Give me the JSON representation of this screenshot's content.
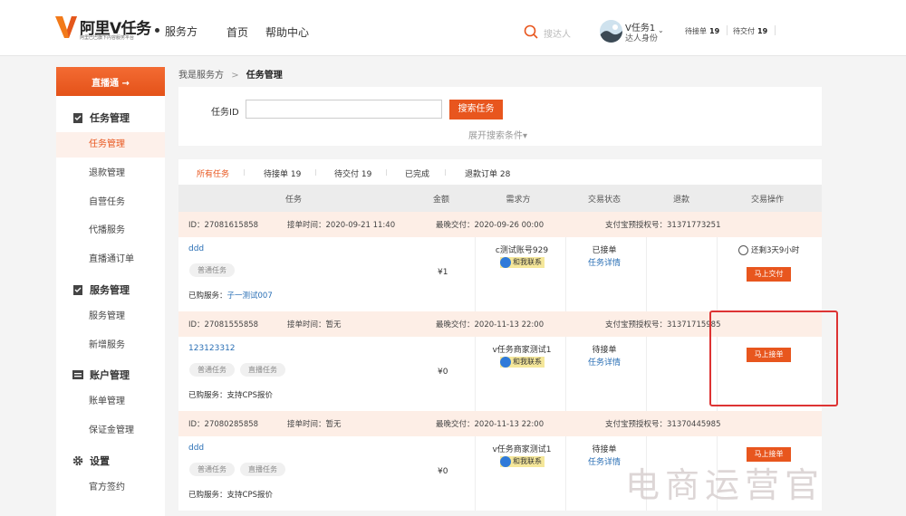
{
  "header": {
    "logo_title": "阿里V任务",
    "logo_sub": "阿里巴巴旗下内容服务平台",
    "service_label": "服务方",
    "nav": [
      "首页",
      "帮助中心"
    ],
    "search_placeholder": "搜达人",
    "user_name": "V任务1",
    "user_role": "达人身份",
    "stats": [
      {
        "label": "待接单",
        "value": "19"
      },
      {
        "label": "待交付",
        "value": "19"
      }
    ]
  },
  "sidebar": {
    "top_button": "直播通 →",
    "sections": [
      {
        "title": "任务管理",
        "icon": "clipboard-icon",
        "items": [
          "任务管理",
          "退款管理",
          "自营任务",
          "代播服务",
          "直播通订单"
        ]
      },
      {
        "title": "服务管理",
        "icon": "clipboard-icon",
        "items": [
          "服务管理",
          "新增服务"
        ]
      },
      {
        "title": "账户管理",
        "icon": "account-icon",
        "items": [
          "账单管理",
          "保证金管理"
        ]
      },
      {
        "title": "设置",
        "icon": "gear-icon",
        "items": [
          "官方签约"
        ]
      }
    ],
    "active_item": "任务管理"
  },
  "breadcrumb": {
    "parent": "我是服务方",
    "sep": ">",
    "current": "任务管理"
  },
  "search": {
    "label": "任务ID",
    "value": "",
    "button": "搜索任务",
    "expand": "展开搜索条件▾"
  },
  "tabs": [
    {
      "label": "所有任务",
      "active": true
    },
    {
      "label": "待接单 19"
    },
    {
      "label": "待交付 19"
    },
    {
      "label": "已完成"
    },
    {
      "label": "退款订单 28"
    }
  ],
  "columns": [
    "任务",
    "金额",
    "需求方",
    "交易状态",
    "退款",
    "交易操作"
  ],
  "orders": [
    {
      "id": "ID：27081615858",
      "accept_time": "接单时间：2020-09-21 11:40",
      "deadline": "最晚交付：2020-09-26 00:00",
      "alipay": "支付宝预授权号：31371773251",
      "title": "ddd",
      "tags": [
        "普通任务"
      ],
      "bought_label": "已购服务：",
      "bought_value": "子一测试007",
      "bought_is_link": true,
      "amount": "¥1",
      "demander": "c测试账号929",
      "contact": "和我联系",
      "status": "已接单",
      "detail": "任务详情",
      "remain": "还剩3天9小时",
      "action": "马上交付"
    },
    {
      "id": "ID：27081555858",
      "accept_time": "接单时间：暂无",
      "deadline": "最晚交付：2020-11-13 22:00",
      "alipay": "支付宝预授权号：31371715985",
      "title": "123123312",
      "tags": [
        "普通任务",
        "直播任务"
      ],
      "bought_label": "已购服务：",
      "bought_value": "支持CPS报价",
      "bought_is_link": false,
      "amount": "¥0",
      "demander": "v任务商家测试1",
      "contact": "和我联系",
      "status": "待接单",
      "detail": "任务详情",
      "remain": "",
      "action": "马上接单"
    },
    {
      "id": "ID：27080285858",
      "accept_time": "接单时间：暂无",
      "deadline": "最晚交付：2020-11-13 22:00",
      "alipay": "支付宝预授权号：31370445985",
      "title": "ddd",
      "tags": [
        "普通任务",
        "直播任务"
      ],
      "bought_label": "已购服务：",
      "bought_value": "支持CPS报价",
      "bought_is_link": false,
      "amount": "¥0",
      "demander": "v任务商家测试1",
      "contact": "和我联系",
      "status": "待接单",
      "detail": "任务详情",
      "remain": "",
      "action": "马上接单"
    }
  ],
  "watermark": "电商运营官",
  "colors": {
    "accent": "#e8561e",
    "link": "#2a6fb5",
    "order_head_bg": "#fdeee6",
    "highlight": "#dd3333"
  }
}
